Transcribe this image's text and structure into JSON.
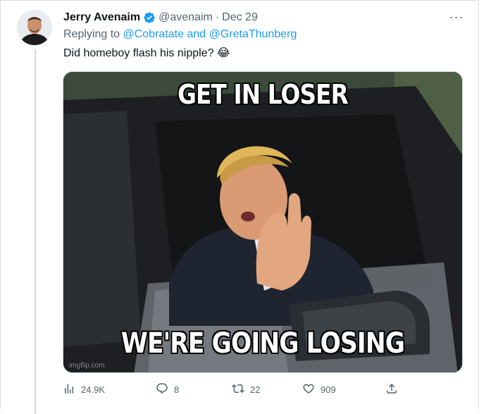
{
  "tweet": {
    "author_name": "Jerry Avenaim",
    "handle": "@avenaim",
    "separator": "·",
    "date": "Dec 29",
    "replying_prefix": "Replying to",
    "replying_mentions": "@Cobratate and @GretaThunberg",
    "text": "Did homeboy flash his nipple? 😂",
    "more_label": "···"
  },
  "media": {
    "top_caption": "GET IN LOSER",
    "bottom_caption": "WE'RE GOING LOSING",
    "watermark": "imgflip.com"
  },
  "actions": {
    "views": "24.9K",
    "replies": "8",
    "retweets": "22",
    "likes": "909"
  },
  "colors": {
    "accent": "#1d9bf0",
    "secondary_text": "#536471",
    "verified": "#1d9bf0"
  },
  "icons": [
    "verified-badge-icon",
    "more-icon",
    "views-icon",
    "reply-icon",
    "retweet-icon",
    "like-icon",
    "share-icon"
  ]
}
